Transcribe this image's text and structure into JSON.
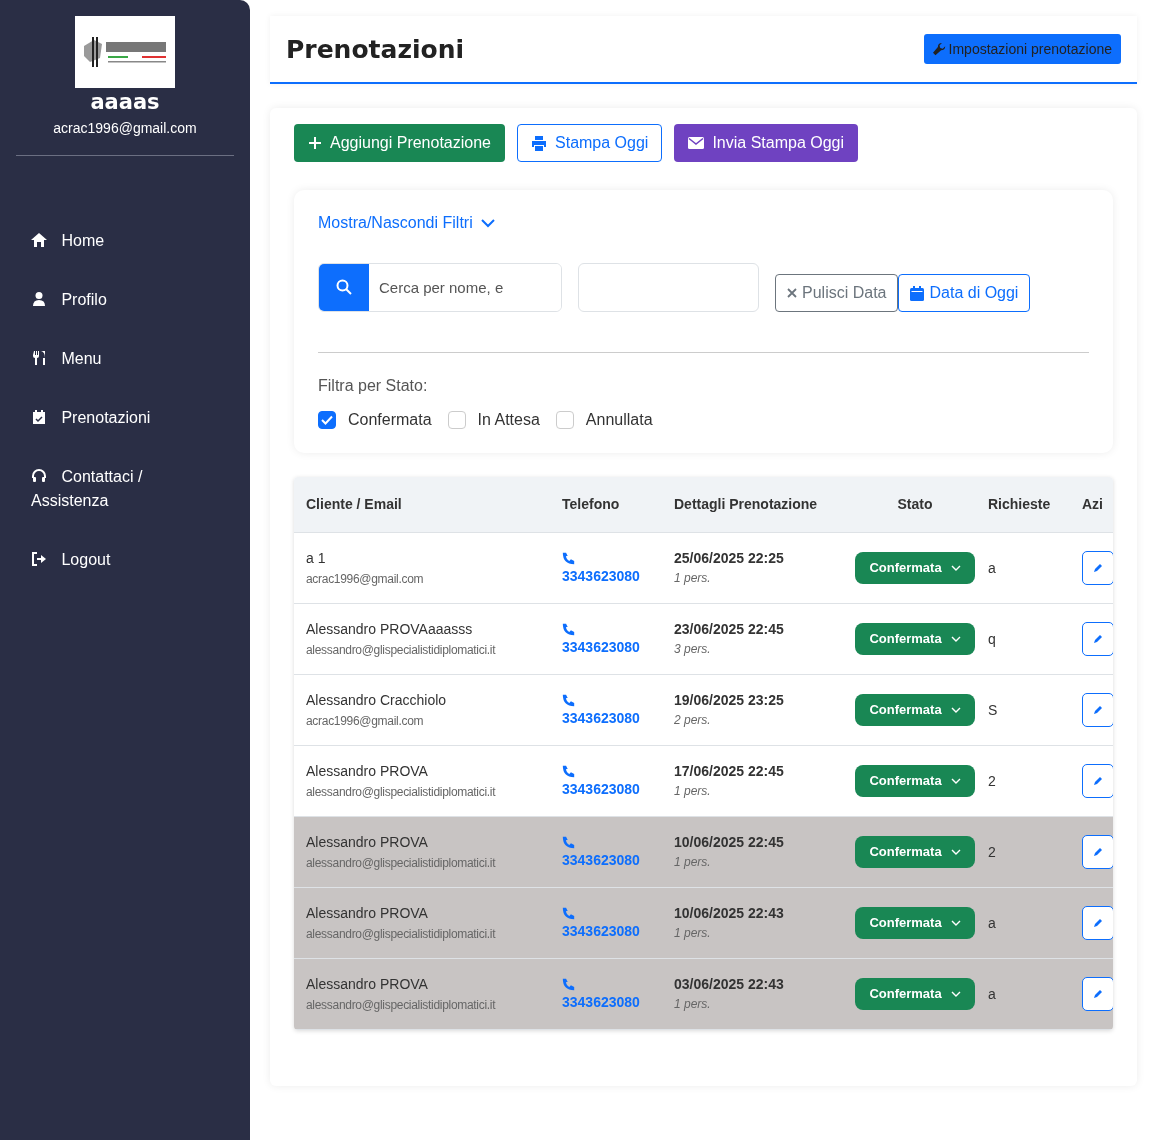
{
  "sidebar": {
    "user_name": "aaaas",
    "user_email": "acrac1996@gmail.com",
    "items": [
      {
        "label": "Home"
      },
      {
        "label": "Profilo"
      },
      {
        "label": "Menu"
      },
      {
        "label": "Prenotazioni"
      },
      {
        "label": "Contattaci / Assistenza"
      },
      {
        "label": "Logout"
      }
    ]
  },
  "header": {
    "title": "Prenotazioni",
    "settings_button": "Impostazioni prenotazione"
  },
  "actions": [
    {
      "label": "Aggiungi Prenotazione",
      "kind": "add"
    },
    {
      "label": "Stampa Oggi",
      "kind": "print"
    },
    {
      "label": "Invia Stampa Oggi",
      "kind": "mail"
    }
  ],
  "filters": {
    "toggle": "Mostra/Nascondi Filtri",
    "search_placeholder": "Cerca per nome, e",
    "clear_date": "Pulisci Data",
    "today_date": "Data di Oggi",
    "status_label": "Filtra per Stato:",
    "statuses": [
      {
        "label": "Confermata",
        "checked": true
      },
      {
        "label": "In Attesa",
        "checked": false
      },
      {
        "label": "Annullata",
        "checked": false
      }
    ]
  },
  "table": {
    "columns": [
      "Cliente / Email",
      "Telefono",
      "Dettagli Prenotazione",
      "Stato",
      "Richieste",
      "Azi"
    ],
    "rows": [
      {
        "name": "a 1",
        "email": "acrac1996@gmail.com",
        "phone": "3343623080",
        "datetime": "25/06/2025 22:25",
        "people": "1 pers.",
        "status": "Confermata",
        "requests": "a",
        "past": false
      },
      {
        "name": "Alessandro PROVAaaasss",
        "email": "alessandro@glispecialistidiplomatici.it",
        "phone": "3343623080",
        "datetime": "23/06/2025 22:45",
        "people": "3 pers.",
        "status": "Confermata",
        "requests": "q",
        "past": false
      },
      {
        "name": "Alessandro Cracchiolo",
        "email": "acrac1996@gmail.com",
        "phone": "3343623080",
        "datetime": "19/06/2025 23:25",
        "people": "2 pers.",
        "status": "Confermata",
        "requests": "S",
        "past": false
      },
      {
        "name": "Alessandro PROVA",
        "email": "alessandro@glispecialistidiplomatici.it",
        "phone": "3343623080",
        "datetime": "17/06/2025 22:45",
        "people": "1 pers.",
        "status": "Confermata",
        "requests": "2",
        "past": false
      },
      {
        "name": "Alessandro PROVA",
        "email": "alessandro@glispecialistidiplomatici.it",
        "phone": "3343623080",
        "datetime": "10/06/2025 22:45",
        "people": "1 pers.",
        "status": "Confermata",
        "requests": "2",
        "past": true
      },
      {
        "name": "Alessandro PROVA",
        "email": "alessandro@glispecialistidiplomatici.it",
        "phone": "3343623080",
        "datetime": "10/06/2025 22:43",
        "people": "1 pers.",
        "status": "Confermata",
        "requests": "a",
        "past": true
      },
      {
        "name": "Alessandro PROVA",
        "email": "alessandro@glispecialistidiplomatici.it",
        "phone": "3343623080",
        "datetime": "03/06/2025 22:43",
        "people": "1 pers.",
        "status": "Confermata",
        "requests": "a",
        "past": true
      }
    ]
  }
}
